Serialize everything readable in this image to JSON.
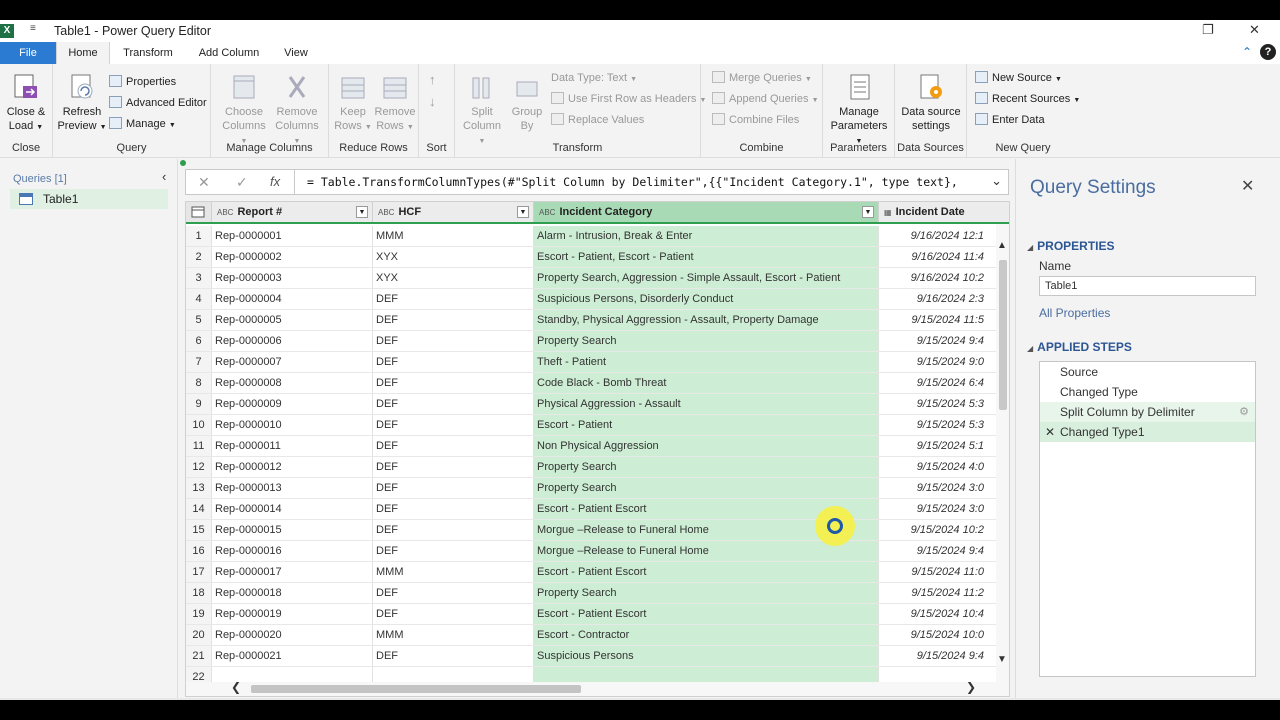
{
  "window": {
    "app_badge": "X",
    "qa_toolbar": "≡",
    "title": "Table1 - Power Query Editor",
    "restore_glyph": "❐",
    "close_glyph": "✕"
  },
  "tabs": [
    {
      "label": "File"
    },
    {
      "label": "Home"
    },
    {
      "label": "Transform"
    },
    {
      "label": "Add Column"
    },
    {
      "label": "View"
    }
  ],
  "ribbon": {
    "close_group": {
      "label": "Close",
      "close_load": "Close &",
      "close_load2": "Load"
    },
    "query_group": {
      "label": "Query",
      "refresh": "Refresh",
      "refresh2": "Preview",
      "properties": "Properties",
      "advanced_editor": "Advanced Editor",
      "manage": "Manage"
    },
    "manage_columns_group": {
      "label": "Manage Columns",
      "choose": "Choose",
      "choose2": "Columns",
      "remove": "Remove",
      "remove2": "Columns"
    },
    "reduce_rows_group": {
      "label": "Reduce Rows",
      "keep": "Keep",
      "keep2": "Rows",
      "remove": "Remove",
      "remove2": "Rows"
    },
    "sort_group": {
      "label": "Sort"
    },
    "transform_group": {
      "label": "Transform",
      "split": "Split",
      "split2": "Column",
      "group": "Group",
      "group2": "By",
      "data_type": "Data Type: Text",
      "first_row": "Use First Row as Headers",
      "replace": "Replace Values"
    },
    "combine_group": {
      "label": "Combine",
      "merge": "Merge Queries",
      "append": "Append Queries",
      "combine_files": "Combine Files"
    },
    "parameters_group": {
      "label": "Parameters",
      "manage": "Manage",
      "manage2": "Parameters"
    },
    "data_sources_group": {
      "label": "Data Sources",
      "settings": "Data source",
      "settings2": "settings"
    },
    "new_query_group": {
      "label": "New Query",
      "new_source": "New Source",
      "recent": "Recent Sources",
      "enter": "Enter Data"
    }
  },
  "queries_pane": {
    "header": "Queries [1]",
    "items": [
      {
        "label": "Table1"
      }
    ]
  },
  "formula_bar": {
    "cancel": "✕",
    "confirm": "✓",
    "fx": "fx",
    "formula": "= Table.TransformColumnTypes(#\"Split Column by Delimiter\",{{\"Incident Category.1\", type text},"
  },
  "grid": {
    "columns": [
      {
        "type": "ABC",
        "name": "Report #"
      },
      {
        "type": "ABC",
        "name": "HCF"
      },
      {
        "type": "ABC",
        "name": "Incident Category"
      },
      {
        "type": "▦",
        "name": "Incident Date"
      }
    ],
    "rows": [
      {
        "n": "1",
        "report": "Rep-0000001",
        "hcf": "MMM",
        "cat": "Alarm - Intrusion, Break & Enter",
        "date": "9/16/2024 12:1"
      },
      {
        "n": "2",
        "report": "Rep-0000002",
        "hcf": "XYX",
        "cat": "Escort - Patient, Escort - Patient",
        "date": "9/16/2024 11:4"
      },
      {
        "n": "3",
        "report": "Rep-0000003",
        "hcf": "XYX",
        "cat": "Property Search, Aggression - Simple Assault, Escort - Patient",
        "date": "9/16/2024 10:2"
      },
      {
        "n": "4",
        "report": "Rep-0000004",
        "hcf": "DEF",
        "cat": "Suspicious Persons, Disorderly Conduct",
        "date": "9/16/2024 2:3"
      },
      {
        "n": "5",
        "report": "Rep-0000005",
        "hcf": "DEF",
        "cat": "Standby, Physical Aggression - Assault, Property Damage",
        "date": "9/15/2024 11:5"
      },
      {
        "n": "6",
        "report": "Rep-0000006",
        "hcf": "DEF",
        "cat": "Property Search",
        "date": "9/15/2024 9:4"
      },
      {
        "n": "7",
        "report": "Rep-0000007",
        "hcf": "DEF",
        "cat": "Theft - Patient",
        "date": "9/15/2024 9:0"
      },
      {
        "n": "8",
        "report": "Rep-0000008",
        "hcf": "DEF",
        "cat": "Code Black - Bomb Threat",
        "date": "9/15/2024 6:4"
      },
      {
        "n": "9",
        "report": "Rep-0000009",
        "hcf": "DEF",
        "cat": "Physical Aggression - Assault",
        "date": "9/15/2024 5:3"
      },
      {
        "n": "10",
        "report": "Rep-0000010",
        "hcf": "DEF",
        "cat": "Escort - Patient",
        "date": "9/15/2024 5:3"
      },
      {
        "n": "11",
        "report": "Rep-0000011",
        "hcf": "DEF",
        "cat": "Non Physical Aggression",
        "date": "9/15/2024 5:1"
      },
      {
        "n": "12",
        "report": "Rep-0000012",
        "hcf": "DEF",
        "cat": "Property Search",
        "date": "9/15/2024 4:0"
      },
      {
        "n": "13",
        "report": "Rep-0000013",
        "hcf": "DEF",
        "cat": "Property Search",
        "date": "9/15/2024 3:0"
      },
      {
        "n": "14",
        "report": "Rep-0000014",
        "hcf": "DEF",
        "cat": "Escort - Patient Escort",
        "date": "9/15/2024 3:0"
      },
      {
        "n": "15",
        "report": "Rep-0000015",
        "hcf": "DEF",
        "cat": "Morgue –Release to Funeral Home",
        "date": "9/15/2024 10:2"
      },
      {
        "n": "16",
        "report": "Rep-0000016",
        "hcf": "DEF",
        "cat": "Morgue –Release to Funeral Home",
        "date": "9/15/2024 9:4"
      },
      {
        "n": "17",
        "report": "Rep-0000017",
        "hcf": "MMM",
        "cat": "Escort - Patient Escort",
        "date": "9/15/2024 11:0"
      },
      {
        "n": "18",
        "report": "Rep-0000018",
        "hcf": "DEF",
        "cat": "Property Search",
        "date": "9/15/2024 11:2"
      },
      {
        "n": "19",
        "report": "Rep-0000019",
        "hcf": "DEF",
        "cat": "Escort - Patient Escort",
        "date": "9/15/2024 10:4"
      },
      {
        "n": "20",
        "report": "Rep-0000020",
        "hcf": "MMM",
        "cat": "Escort - Contractor",
        "date": "9/15/2024 10:0"
      },
      {
        "n": "21",
        "report": "Rep-0000021",
        "hcf": "DEF",
        "cat": "Suspicious Persons",
        "date": "9/15/2024 9:4"
      },
      {
        "n": "22",
        "report": "",
        "hcf": "",
        "cat": "",
        "date": ""
      }
    ]
  },
  "settings": {
    "title": "Query Settings",
    "properties_header": "PROPERTIES",
    "name_label": "Name",
    "name_value": "Table1",
    "all_properties": "All Properties",
    "applied_steps_header": "APPLIED STEPS",
    "steps": [
      {
        "label": "Source"
      },
      {
        "label": "Changed Type"
      },
      {
        "label": "Split Column by Delimiter"
      },
      {
        "label": "Changed Type1"
      }
    ]
  },
  "colors": {
    "accent_green": "#2e9e4f",
    "selected_column": "#cdeed4",
    "file_tab": "#2b7bd3",
    "settings_title": "#4a6da0"
  }
}
